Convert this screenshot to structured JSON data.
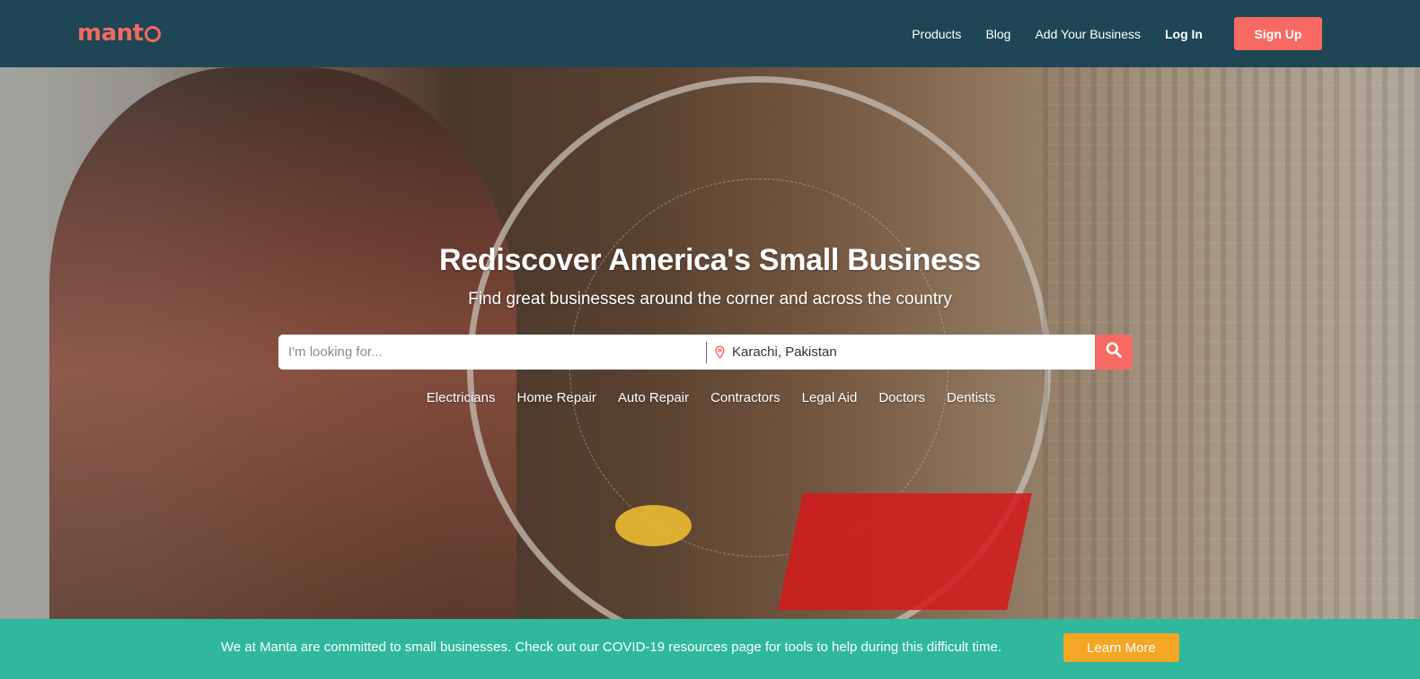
{
  "header": {
    "logo_text": "mant",
    "nav": [
      "Products",
      "Blog",
      "Add Your Business"
    ],
    "login_label": "Log In",
    "signup_label": "Sign Up"
  },
  "hero": {
    "title": "Rediscover America's Small Business",
    "subtitle": "Find great businesses around the corner and across the country",
    "search": {
      "what_placeholder": "I'm looking for...",
      "where_value": "Karachi, Pakistan"
    },
    "categories": [
      "Electricians",
      "Home Repair",
      "Auto Repair",
      "Contractors",
      "Legal Aid",
      "Doctors",
      "Dentists"
    ]
  },
  "banner": {
    "text": "We at Manta are committed to small businesses. Check out our COVID-19 resources page for tools to help during this difficult time.",
    "button_label": "Learn More"
  },
  "icons": {
    "location": "map-pin-icon",
    "search": "magnifier-icon"
  },
  "colors": {
    "topbar": "#1e4655",
    "accent_red": "#f76a64",
    "banner": "#2fb89d",
    "learn_more": "#f5a623"
  }
}
